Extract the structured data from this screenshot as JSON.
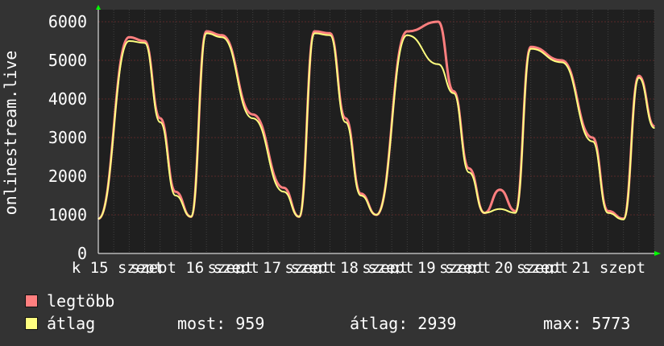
{
  "chart_data": {
    "type": "line",
    "ylabel": "onlinestream.live",
    "ylim": [
      0,
      6000
    ],
    "yticks": [
      "0",
      "1000",
      "2000",
      "3000",
      "4000",
      "5000",
      "6000"
    ],
    "xticks": [
      "k 15 szept",
      "szept 16 szept",
      "szept 17 szept",
      "szept 18 szept",
      "szept 19 szept",
      "szept 20 szept",
      "szept 21 szept"
    ],
    "grid": true,
    "series": [
      {
        "name": "legtöbb",
        "color": "#ff7f7f",
        "x": [
          0.0,
          0.4,
          0.6,
          0.8,
          1.0,
          1.2,
          1.4,
          1.6,
          2.0,
          2.4,
          2.6,
          2.8,
          3.0,
          3.2,
          3.4,
          3.6,
          4.0,
          4.4,
          4.6,
          4.8,
          5.0,
          5.2,
          5.4,
          5.6,
          6.0,
          6.4,
          6.6,
          6.8,
          7.0,
          7.2
        ],
        "y": [
          900,
          5600,
          5500,
          3500,
          1600,
          950,
          5750,
          5650,
          3600,
          1700,
          950,
          5750,
          5700,
          3500,
          1550,
          1000,
          5750,
          6000,
          4200,
          2200,
          1050,
          1650,
          1100,
          5350,
          5000,
          3000,
          1100,
          900,
          4600,
          3300
        ]
      },
      {
        "name": "átlag",
        "color": "#ffff80",
        "x": [
          0.0,
          0.4,
          0.6,
          0.8,
          1.0,
          1.2,
          1.4,
          1.6,
          2.0,
          2.4,
          2.6,
          2.8,
          3.0,
          3.2,
          3.4,
          3.6,
          4.0,
          4.4,
          4.6,
          4.8,
          5.0,
          5.2,
          5.4,
          5.6,
          6.0,
          6.4,
          6.6,
          6.8,
          7.0,
          7.2
        ],
        "y": [
          900,
          5500,
          5450,
          3400,
          1500,
          950,
          5700,
          5600,
          3500,
          1600,
          950,
          5700,
          5650,
          3400,
          1500,
          1000,
          5650,
          4900,
          4150,
          2100,
          1050,
          1150,
          1050,
          5300,
          4950,
          2900,
          1050,
          880,
          4550,
          3250
        ]
      }
    ],
    "legend": {
      "placement": "bottom-left",
      "items": [
        {
          "label": "legtöbb",
          "color": "#ff7f7f"
        },
        {
          "label": "átlag",
          "color": "#ffff80"
        }
      ],
      "stats": {
        "most": "most: 959",
        "atlag": "átlag: 2939",
        "max": "max: 5773"
      }
    }
  }
}
